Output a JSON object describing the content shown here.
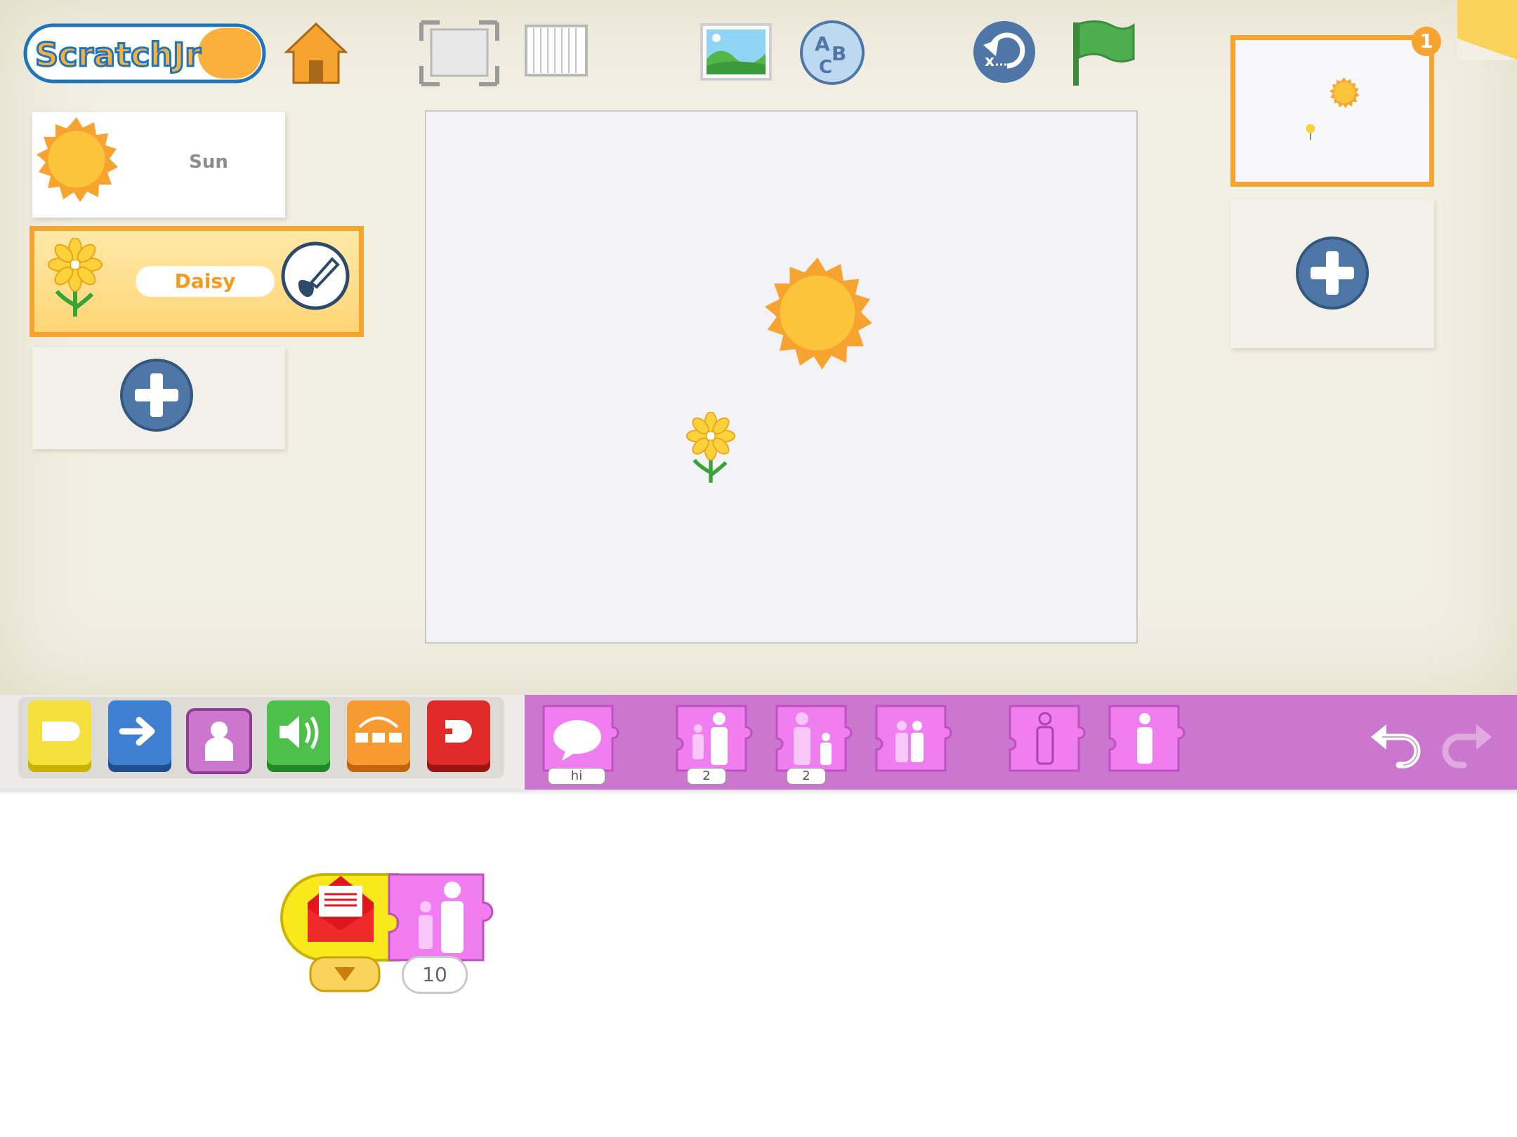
{
  "app": {
    "logo_text": "ScratchJr"
  },
  "sprites": [
    {
      "label": "Sun"
    },
    {
      "label": "Daisy"
    }
  ],
  "pages": {
    "badge": "1"
  },
  "palette": {
    "categories": [
      "triggering",
      "motion",
      "looks",
      "sound",
      "control",
      "end"
    ],
    "selected_category": "looks",
    "blocks": [
      {
        "name": "say",
        "arg": "hi"
      },
      {
        "name": "grow",
        "arg": "2"
      },
      {
        "name": "shrink",
        "arg": "2"
      },
      {
        "name": "reset-size",
        "arg": ""
      },
      {
        "name": "hide",
        "arg": ""
      },
      {
        "name": "show",
        "arg": ""
      }
    ]
  },
  "script": {
    "trigger": "when-message-received",
    "trigger_color": "red",
    "action": "grow",
    "action_arg": "10"
  },
  "colors": {
    "accent_orange": "#f7a330",
    "looks_purple": "#cc77cf",
    "button_blue": "#4e76a6"
  }
}
